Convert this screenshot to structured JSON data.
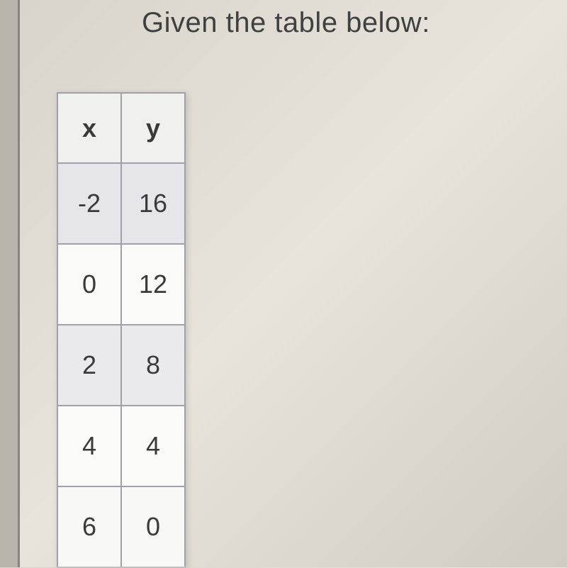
{
  "title": "Given the table below:",
  "chart_data": {
    "type": "table",
    "columns": [
      "x",
      "y"
    ],
    "rows": [
      {
        "x": "-2",
        "y": "16"
      },
      {
        "x": "0",
        "y": "12"
      },
      {
        "x": "2",
        "y": "8"
      },
      {
        "x": "4",
        "y": "4"
      },
      {
        "x": "6",
        "y": "0"
      }
    ]
  }
}
